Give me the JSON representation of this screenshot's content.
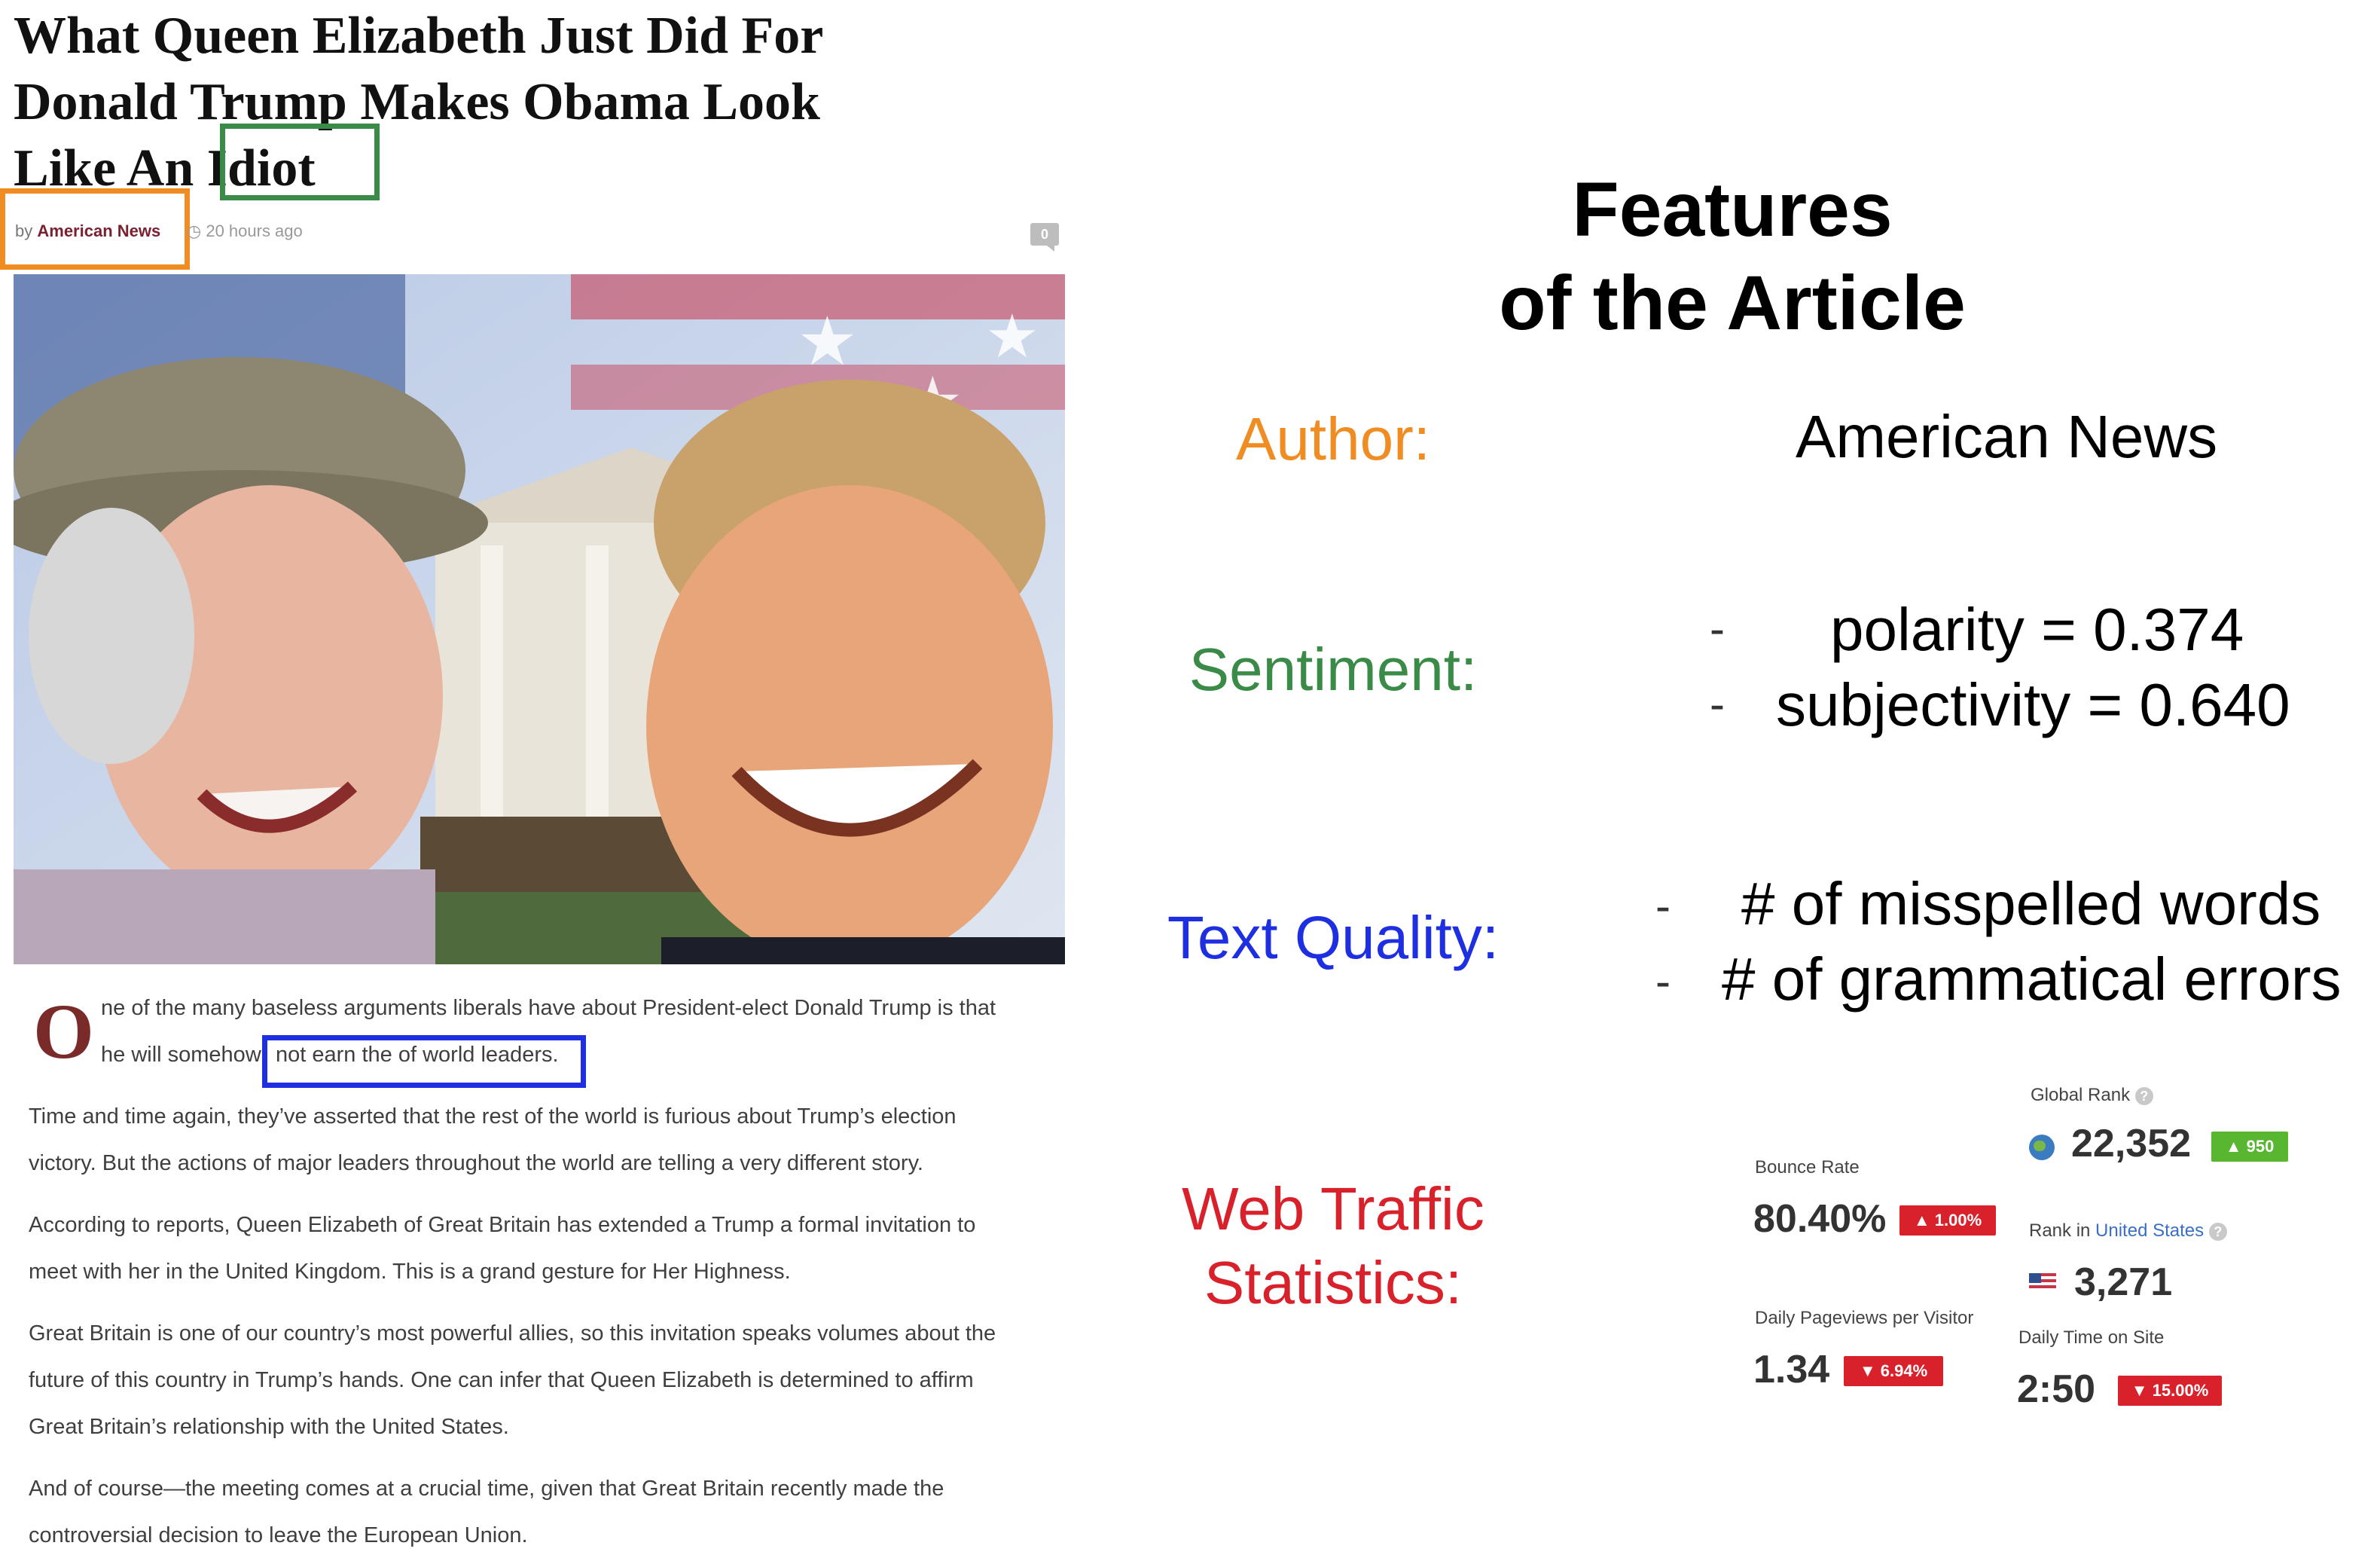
{
  "article": {
    "headline_lines": [
      "What Queen Elizabeth Just Did For",
      "Donald Trump Makes Obama Look",
      "Like An Idiot"
    ],
    "byline_prefix": "by",
    "author": "American News",
    "time": "20 hours ago",
    "comments": "0",
    "dropcap": "O",
    "paragraphs": [
      "ne of the many baseless arguments liberals have about President-elect Donald Trump is that",
      "he will somehow",
      "not earn the of world leaders.",
      "Time and time again, they’ve asserted that the rest of the world is furious about Trump’s election",
      "victory. But the actions of major leaders throughout the world are telling a very different story.",
      "According to reports, Queen Elizabeth of Great Britain has extended a Trump a formal invitation to",
      "meet with her in the United Kingdom. This is a grand gesture for Her Highness.",
      "Great Britain is one of our country’s most powerful allies, so this invitation speaks volumes about the",
      "future of this country in Trump’s hands. One can infer that Queen Elizabeth is determined to affirm",
      "Great Britain’s relationship with the United States.",
      "And of course—the meeting comes at a crucial time, given that Great Britain recently made the",
      "controversial decision to leave the European Union."
    ]
  },
  "features": {
    "title_lines": [
      "Features",
      "of the Article"
    ],
    "author_label": "Author:",
    "author_value": "American News",
    "sentiment_label": "Sentiment:",
    "sentiment_values": [
      "polarity = 0.374",
      "subjectivity = 0.640"
    ],
    "quality_label": "Text Quality:",
    "quality_values": [
      "# of misspelled words",
      "# of grammatical errors"
    ],
    "traffic_label_lines": [
      "Web Traffic",
      "Statistics:"
    ],
    "dash": "-"
  },
  "traffic": {
    "global_rank_label": "Global Rank",
    "global_rank": "22,352",
    "global_rank_change": "950",
    "bounce_rate_label": "Bounce Rate",
    "bounce_rate": "80.40%",
    "bounce_rate_change": "1.00%",
    "rank_in_label": "Rank in",
    "rank_in_country": "United States",
    "country_rank": "3,271",
    "pageviews_label": "Daily Pageviews per Visitor",
    "pageviews": "1.34",
    "pageviews_change": "6.94%",
    "time_on_site_label": "Daily Time on Site",
    "time_on_site": "2:50",
    "time_on_site_change": "15.00%"
  },
  "colors": {
    "author": "#ef8d22",
    "sentiment": "#3a8a48",
    "quality": "#1d2fe0",
    "traffic": "#d8212a"
  }
}
